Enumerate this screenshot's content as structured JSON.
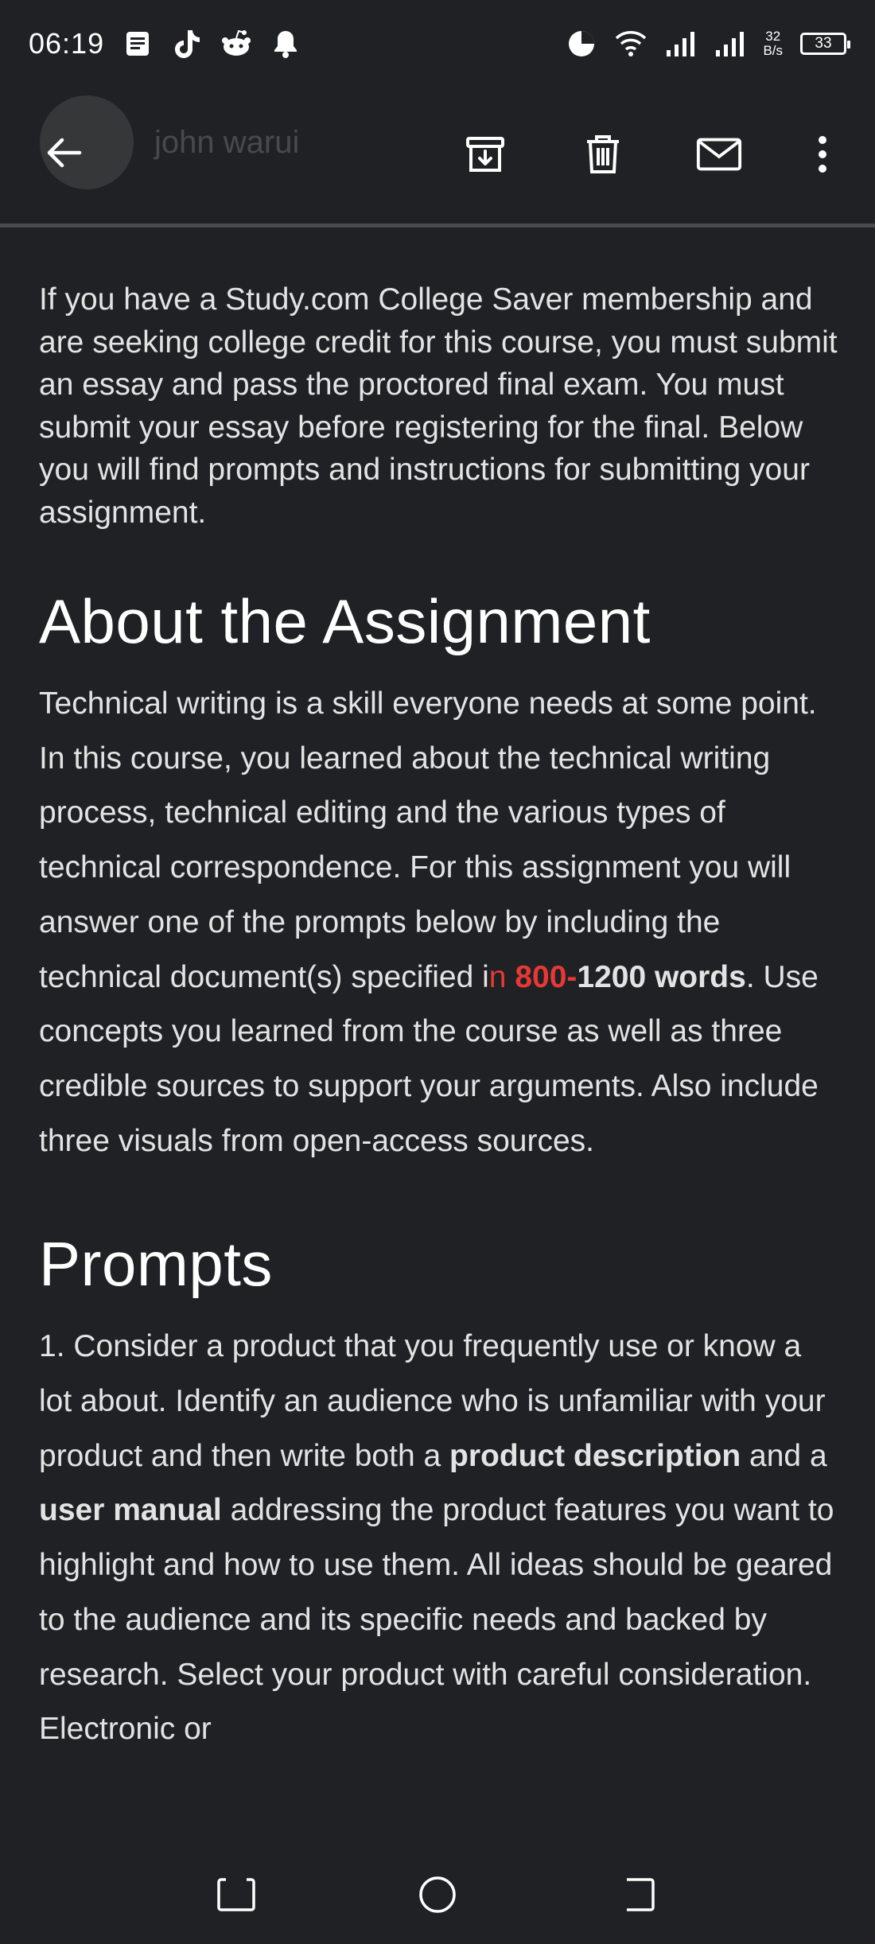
{
  "status": {
    "time": "06:19",
    "speed_value": "32",
    "speed_unit": "B/s",
    "battery": "33"
  },
  "header": {
    "sender": "john warui"
  },
  "body": {
    "intro": "If you have a Study.com College Saver membership and are seeking college credit for this course, you must submit an essay and pass the proctored final exam. You must submit your essay before registering for the final. Below you will find prompts and instructions for submitting your assignment.",
    "about_heading": "About the Assignment",
    "about_part1": "Technical writing is a skill everyone needs at some point. In this course, you learned about the technical writing process, technical editing and the various types of technical correspondence. For this assignment you will answer one of the prompts below by including the technical document(s) specified i",
    "about_red_n": "n ",
    "about_red_bold": "800-",
    "about_bold": "1200 words",
    "about_part2": ". Use concepts you learned from the course as well as three credible sources to support your arguments. Also include three visuals from open-access sources.",
    "prompts_heading": "Prompts",
    "prompt1_part1": "1. Consider a product that you frequently use or know a lot about. Identify an audience who is unfamiliar with your product and then write both a ",
    "prompt1_bold1": "product description",
    "prompt1_part2": " and a ",
    "prompt1_bold2": "user manual",
    "prompt1_part3": " addressing the product features you want to highlight and how to use them. All ideas should be geared to the audience and its specific needs and backed by research. Select your product with careful consideration. Electronic or"
  },
  "colors": {
    "background": "#202124",
    "text": "#e3e3e3",
    "accent_red": "#e53935"
  }
}
